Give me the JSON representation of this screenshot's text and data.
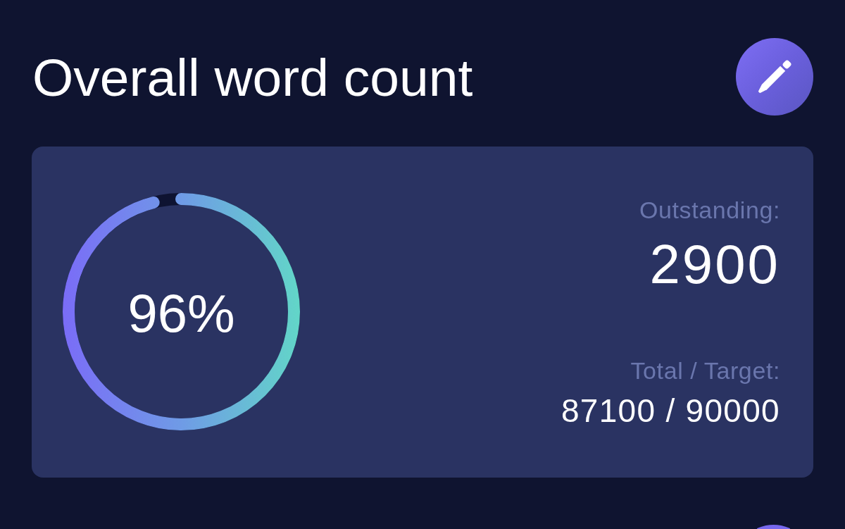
{
  "title": "Overall word count",
  "progress": {
    "level": 0.96,
    "reading": "96%"
  },
  "stats": [
    {
      "kind": "large",
      "label": "Outstanding:",
      "value": "2900"
    },
    {
      "kind": "medium",
      "label": "Total / Target:",
      "value": "87100 / 90000"
    }
  ]
}
